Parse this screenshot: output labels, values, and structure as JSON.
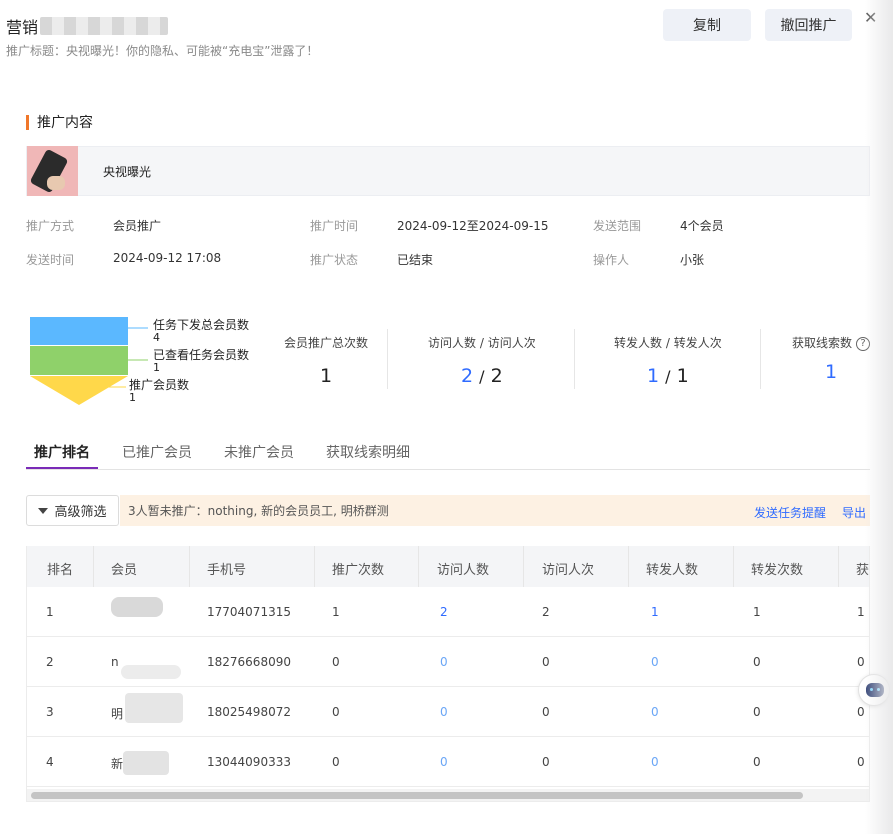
{
  "header": {
    "title": "营销",
    "subtitle": "推广标题：央视曝光！你的隐私、可能被“充电宝”泄露了！",
    "copy_label": "复制",
    "withdraw_label": "撤回推广",
    "close_glyph": "✕"
  },
  "section": {
    "title": "推广内容"
  },
  "content": {
    "label": "央视曝光"
  },
  "info": {
    "method_key": "推广方式",
    "method_val": "会员推广",
    "time_key": "推广时间",
    "time_val": "2024-09-12至2024-09-15",
    "scope_key": "发送范围",
    "scope_val": "4个会员",
    "send_key": "发送时间",
    "send_val": "2024-09-12 17:08",
    "status_key": "推广状态",
    "status_val": "已结束",
    "operator_key": "操作人",
    "operator_val": "小张"
  },
  "funnel": {
    "levels": [
      {
        "label": "任务下发总会员数",
        "value": "4",
        "color": "#5bb8ff"
      },
      {
        "label": "已查看任务会员数",
        "value": "1",
        "color": "#8fd16a"
      },
      {
        "label": "推广会员数",
        "value": "1",
        "color": "#ffd84a"
      }
    ]
  },
  "stats": {
    "total_label": "会员推广总次数",
    "total_value": "1",
    "visit_label_a": "访问人数",
    "visit_sep": "/",
    "visit_label_b": "访问人次",
    "visit_a": "2",
    "visit_b": "2",
    "share_label_a": "转发人数",
    "share_sep": "/",
    "share_label_b": "转发人次",
    "share_a": "1",
    "share_b": "1",
    "leads_label": "获取线索数",
    "leads_value": "1",
    "help_glyph": "?"
  },
  "tabs": [
    "推广排名",
    "已推广会员",
    "未推广会员",
    "获取线索明细"
  ],
  "filter": {
    "label": "高级筛选"
  },
  "notice": {
    "text": "3人暂未推广：nothing, 新的会员员工, 明桥群测",
    "remind_link": "发送任务提醒",
    "export_link": "导出"
  },
  "table": {
    "headers": [
      "排名",
      "会员",
      "手机号",
      "推广次数",
      "访问人数",
      "访问人次",
      "转发人数",
      "转发次数",
      "获取"
    ],
    "rows": [
      {
        "rank": "1",
        "member": "",
        "phone": "17704071315",
        "promos": "1",
        "visitors": "2",
        "visits": "2",
        "sharers": "1",
        "shares": "1",
        "leads": "1"
      },
      {
        "rank": "2",
        "member": "n",
        "phone": "18276668090",
        "promos": "0",
        "visitors": "0",
        "visits": "0",
        "sharers": "0",
        "shares": "0",
        "leads": "0"
      },
      {
        "rank": "3",
        "member": "明",
        "phone": "18025498072",
        "promos": "0",
        "visitors": "0",
        "visits": "0",
        "sharers": "0",
        "shares": "0",
        "leads": "0"
      },
      {
        "rank": "4",
        "member": "新",
        "phone": "13044090333",
        "promos": "0",
        "visitors": "0",
        "visits": "0",
        "sharers": "0",
        "shares": "0",
        "leads": "0"
      }
    ]
  }
}
